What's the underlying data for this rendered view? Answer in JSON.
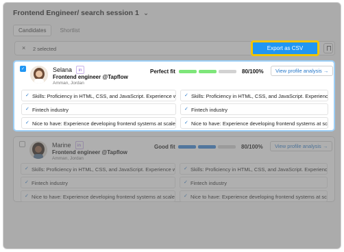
{
  "header": {
    "title": "Frontend Engineer/ search session 1"
  },
  "tabs": [
    "Candidates",
    "Shortlist"
  ],
  "toolbar": {
    "selected_text": "2 selected",
    "export_label": "Export as CSV",
    "close_glyph": "×"
  },
  "candidates": [
    {
      "name": "Selana",
      "role": "Frontend engineer @Tapflow",
      "location": "Amman, Jordan",
      "fit": "Perfect fit",
      "score": "80/100%",
      "fit_level_fraction": 0.8,
      "bar_color": "#7ee67a",
      "analysis_label": "View profile analysis →",
      "selected": true,
      "criteria_left": [
        "Skills: Proficiency in HTML, CSS, and JavaScript. Experience wit",
        "Fintech industry",
        "Nice to have: Experience developing frontend systems at scale"
      ],
      "criteria_right": [
        "Skills: Proficiency in HTML, CSS, and JavaScript. Experience wit",
        "Fintech industry",
        "Nice to have: Experience developing frontend systems at scale"
      ]
    },
    {
      "name": "Marine",
      "role": "Frontend engineer @Tapflow",
      "location": "Amman, Jordan",
      "fit": "Good fit",
      "score": "80/100%",
      "fit_level_fraction": 0.8,
      "bar_color": "#2f80d8",
      "analysis_label": "View profile analysis →",
      "selected": false,
      "criteria_left": [
        "Skills: Proficiency in HTML, CSS, and JavaScript. Experience wit",
        "Fintech industry",
        "Nice to have: Experience developing frontend systems at scale"
      ],
      "criteria_right": [
        "Skills: Proficiency in HTML, CSS, and JavaScript. Experience wit",
        "Fintech industry",
        "Nice to have: Experience developing frontend systems at scale"
      ]
    }
  ],
  "icons": {
    "check": "✓",
    "linkedin": "in",
    "chevron": "⌄",
    "bookmark": "bookmark-icon"
  }
}
